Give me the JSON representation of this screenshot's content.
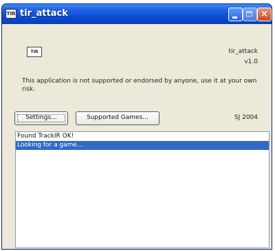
{
  "window": {
    "title": "tir_attack",
    "icon_label": "TIR",
    "controls": [
      "minimize-icon",
      "maximize-icon",
      "close-icon"
    ],
    "close_glyph": "✕"
  },
  "header": {
    "logo_label": "TIR",
    "app_name": "tir_attack",
    "version": "v1.0"
  },
  "disclaimer": "This application is not supported or endorsed by anyone, use it at your own risk.",
  "buttons": {
    "settings": "Settings...",
    "supported_games": "Supported Games..."
  },
  "copyright": "SJ 2004",
  "log": {
    "lines": [
      {
        "text": "Found TrackIR OK!",
        "selected": false
      },
      {
        "text": "Looking for a game...",
        "selected": true
      }
    ]
  },
  "colors": {
    "titlebar": "#0a48d0",
    "selection": "#316ac5",
    "window_bg": "#ece9d8"
  }
}
